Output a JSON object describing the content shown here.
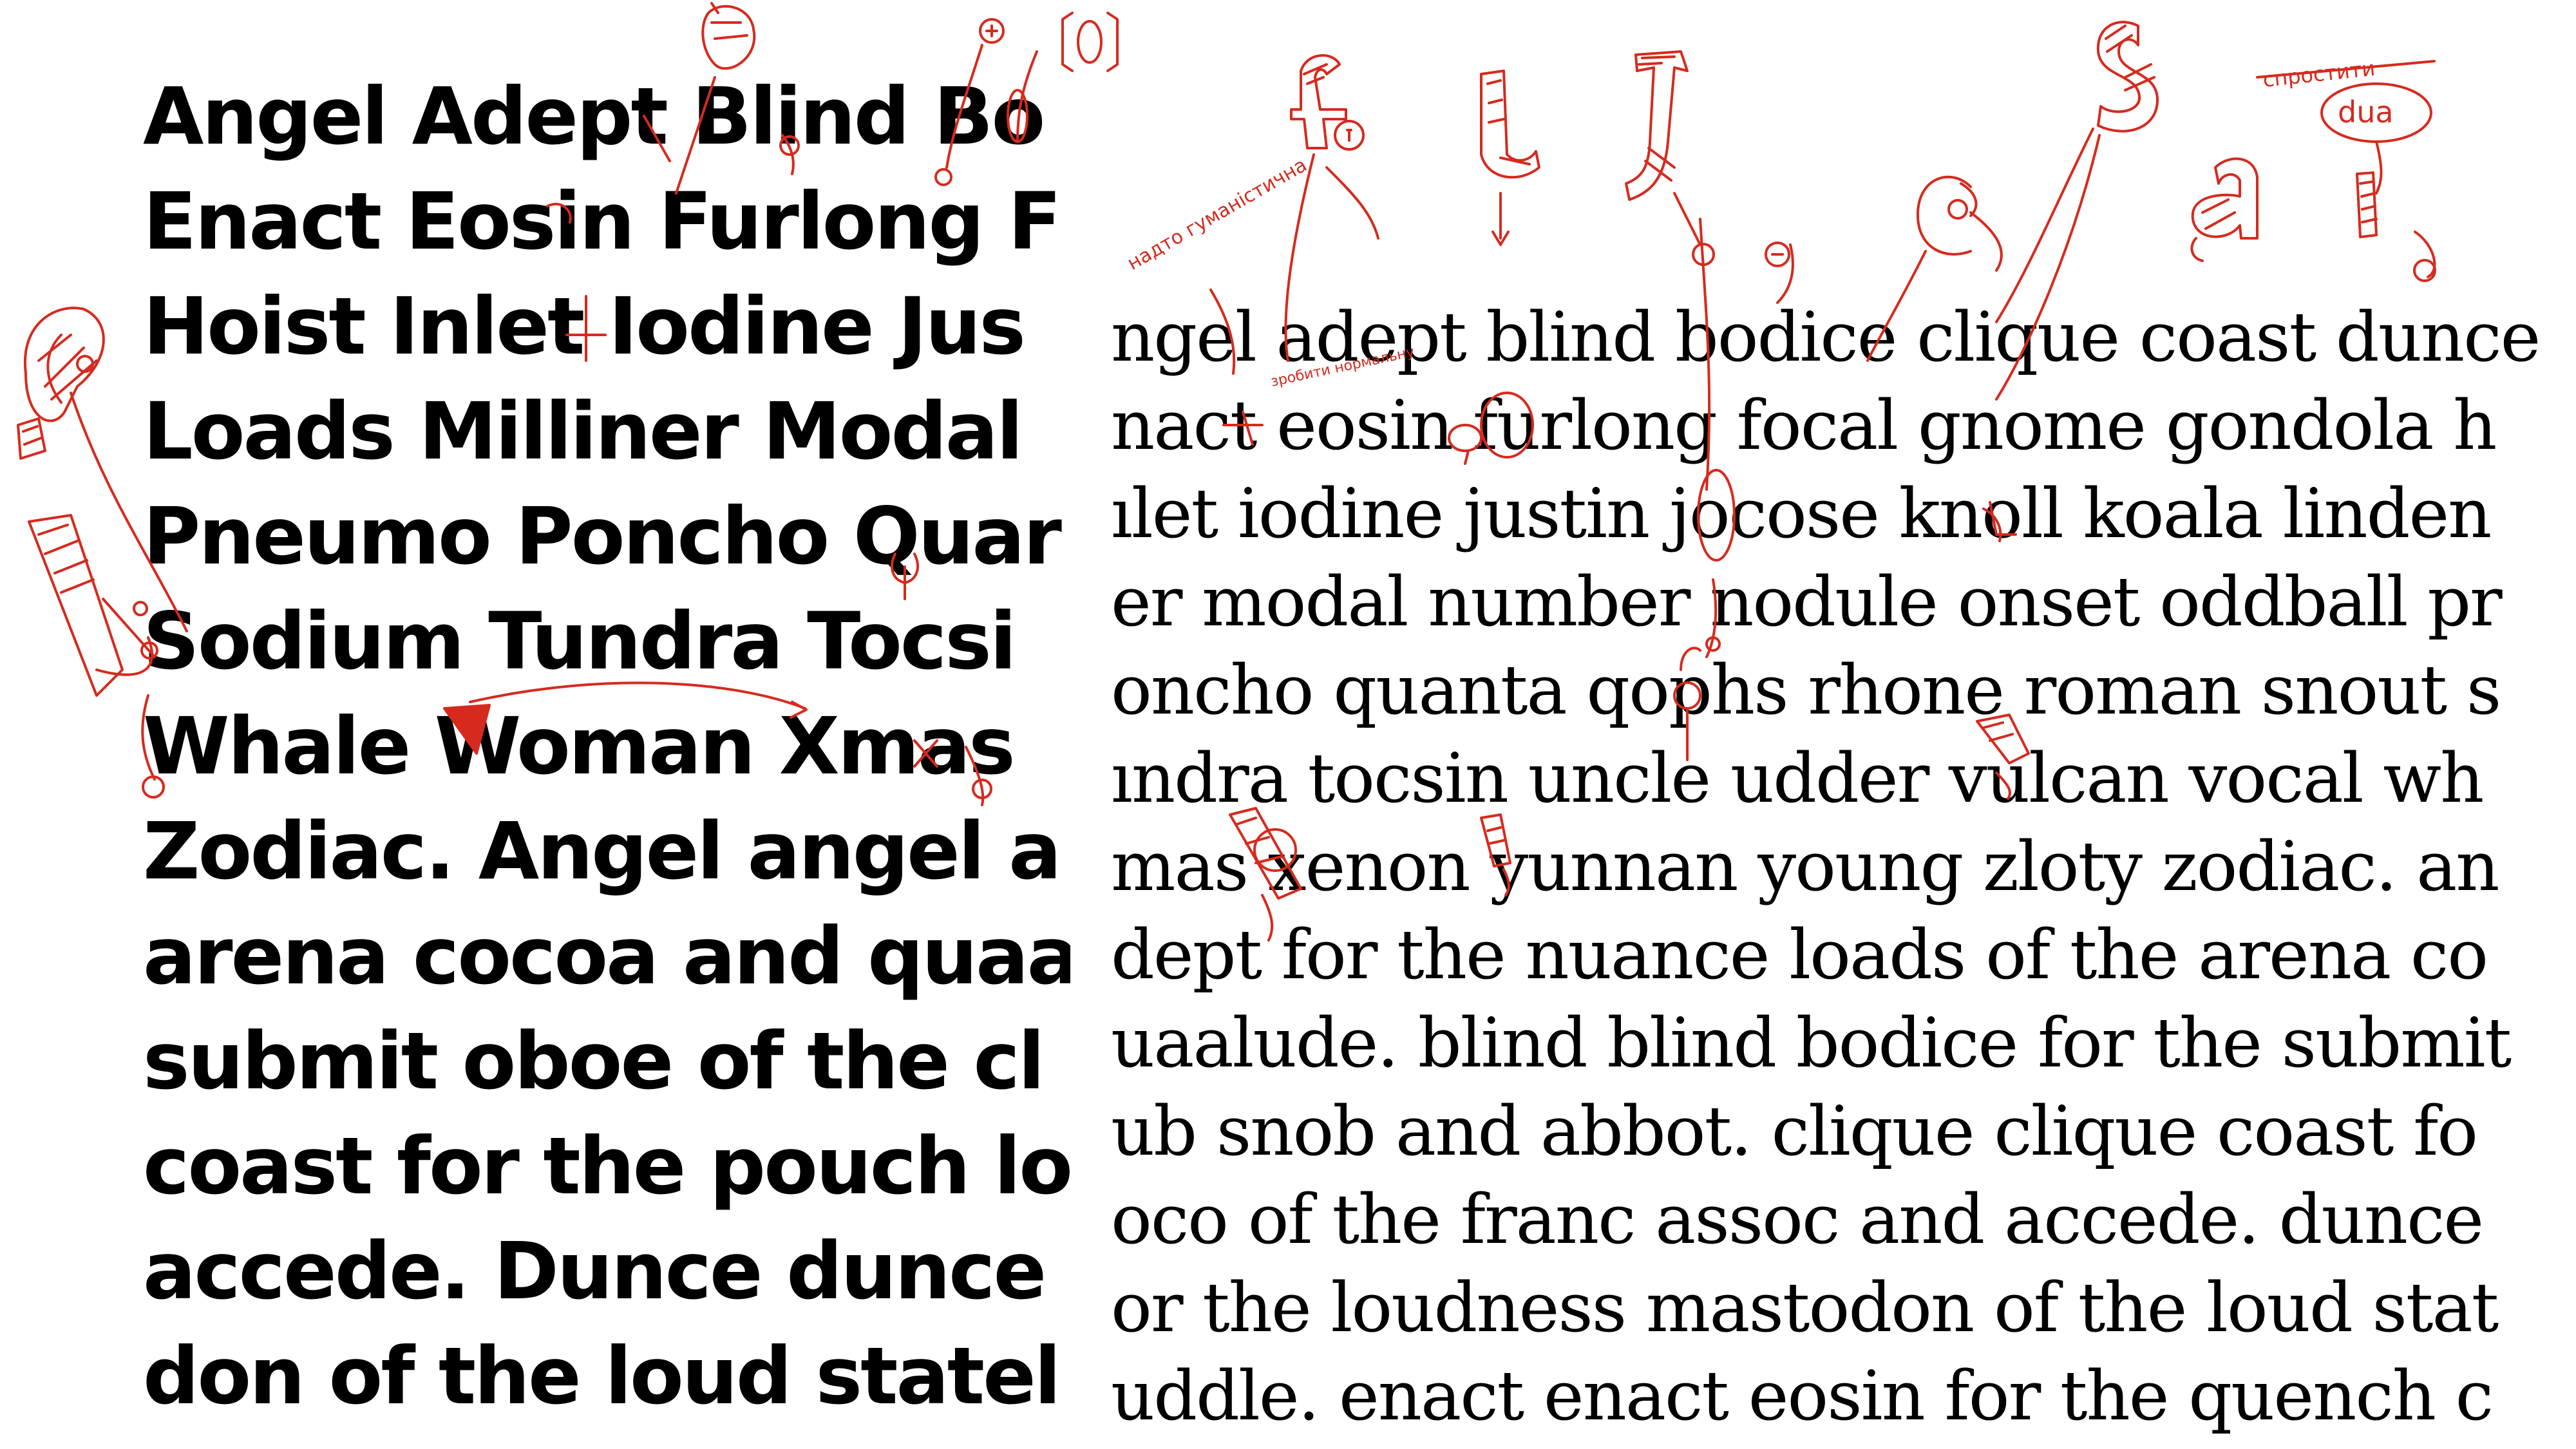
{
  "colors": {
    "ink": "#000000",
    "sketch": "#d62a1e",
    "background": "#ffffff"
  },
  "left_specimen": {
    "lines": [
      "Angel Adept Blind Bo",
      "Enact Eosin Furlong F",
      "Hoist Inlet Iodine Jus",
      "Loads Milliner Modal",
      "Pneumo Poncho Quar",
      "Sodium Tundra Tocsi",
      "Whale Woman Xmas",
      "Zodiac. Angel angel a",
      "arena cocoa and quaa",
      "submit oboe of the cl",
      "coast for the pouch lo",
      "accede. Dunce dunce",
      "don of the loud statel"
    ]
  },
  "right_specimen": {
    "lines": [
      "ngel adept blind bodice clique coast dunce",
      "nact eosin furlong focal gnome gondola h",
      "ılet iodine justin jocose knoll koala linden",
      "er modal number nodule onset oddball pr",
      "oncho quanta qophs rhone roman snout s",
      "ındra tocsin uncle udder vulcan vocal wh",
      "mas xenon yunnan young zloty zodiac. an",
      "dept for the nuance loads of the arena co",
      "uaalude. blind blind bodice for the submit",
      "ub snob and abbot. clique clique coast fo",
      "oco of the franc assoc and accede. dunce",
      "or the loudness mastodon of the loud stat",
      "uddle. enact enact eosin for the quench c"
    ]
  },
  "annotations": {
    "note_left": "надто гуманістична",
    "note_small": "зробити нормальну",
    "note_top": "спростити",
    "note_dua": "dua"
  }
}
